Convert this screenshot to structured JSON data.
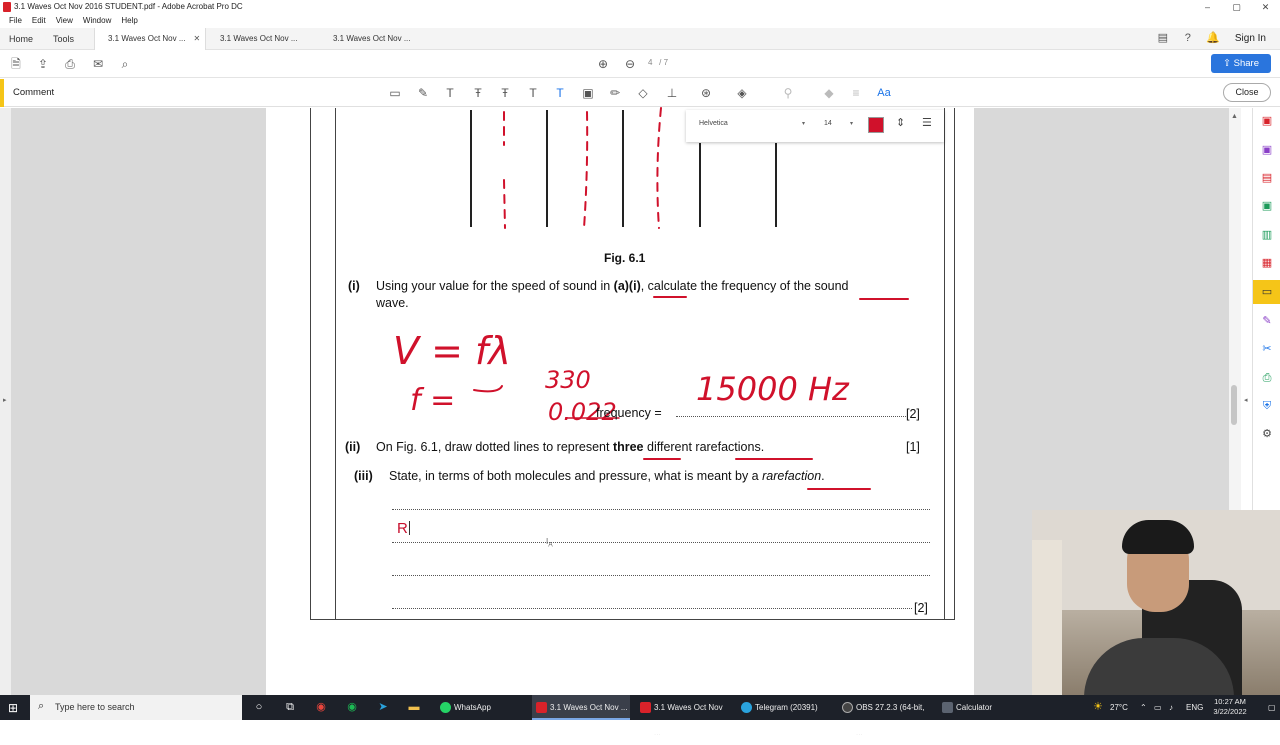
{
  "window": {
    "title": "3.1 Waves Oct Nov 2016 STUDENT.pdf - Adobe Acrobat Pro DC",
    "controls": [
      "–",
      "▢",
      "✕"
    ]
  },
  "menu": [
    "File",
    "Edit",
    "View",
    "Window",
    "Help"
  ],
  "tabs": {
    "home": "Home",
    "tools": "Tools",
    "docs": [
      "3.1 Waves Oct Nov ...",
      "3.1 Waves Oct Nov ...",
      "3.1 Waves Oct Nov ..."
    ],
    "close_glyph": "✕"
  },
  "header_right": {
    "sign_in": "Sign In"
  },
  "toolbar": {
    "page_current": "4",
    "page_total": "/ 7",
    "share": "Share"
  },
  "comment_bar": {
    "label": "Comment",
    "close": "Close",
    "font_tool": "Aa"
  },
  "text_props": {
    "font": "Helvetica",
    "size": "14",
    "color": "#d0112b"
  },
  "document": {
    "figure_caption": "Fig. 6.1",
    "q_i_num": "(i)",
    "q_i_text_a": "Using your value for the speed of sound in ",
    "q_i_ref": "(a)(i)",
    "q_i_text_b": ", calculate the frequency of the sound",
    "q_i_text_c": "wave.",
    "frequency_label": "frequency = ",
    "q_i_marks": "[2]",
    "q_ii_num": "(ii)",
    "q_ii_text_a": "On Fig. 6.1, draw dotted lines to represent ",
    "q_ii_bold": "three",
    "q_ii_text_b": " different rarefactions.",
    "q_ii_marks": "[1]",
    "q_iii_num": "(iii)",
    "q_iii_text_a": "State, in terms of both molecules and pressure, what is meant by a ",
    "q_iii_italic": "rarefaction",
    "q_iii_text_b": ".",
    "q_iii_marks": "[2]",
    "typed_answer": "R"
  },
  "annotations": {
    "line1": "V = fλ",
    "line2_left": "f =",
    "line2_num": "330",
    "line2_den": "0.022",
    "answer": "15000 Hz",
    "color": "#d0112b"
  },
  "taskbar": {
    "search_placeholder": "Type here to search",
    "apps": [
      {
        "label": "WhatsApp",
        "color": "#25d366"
      },
      {
        "label": "3.1 Waves Oct Nov ...",
        "color": "#d8222a"
      },
      {
        "label": "3.1 Waves Oct Nov ...",
        "color": "#d8222a"
      },
      {
        "label": "Telegram (20391)",
        "color": "#2aa3dd"
      },
      {
        "label": "OBS 27.2.3 (64-bit, ...",
        "color": "#444444"
      },
      {
        "label": "Calculator",
        "color": "#5b6370"
      }
    ],
    "weather": "27°C",
    "lang": "ENG",
    "time": "10:27 AM",
    "date": "3/22/2022"
  }
}
